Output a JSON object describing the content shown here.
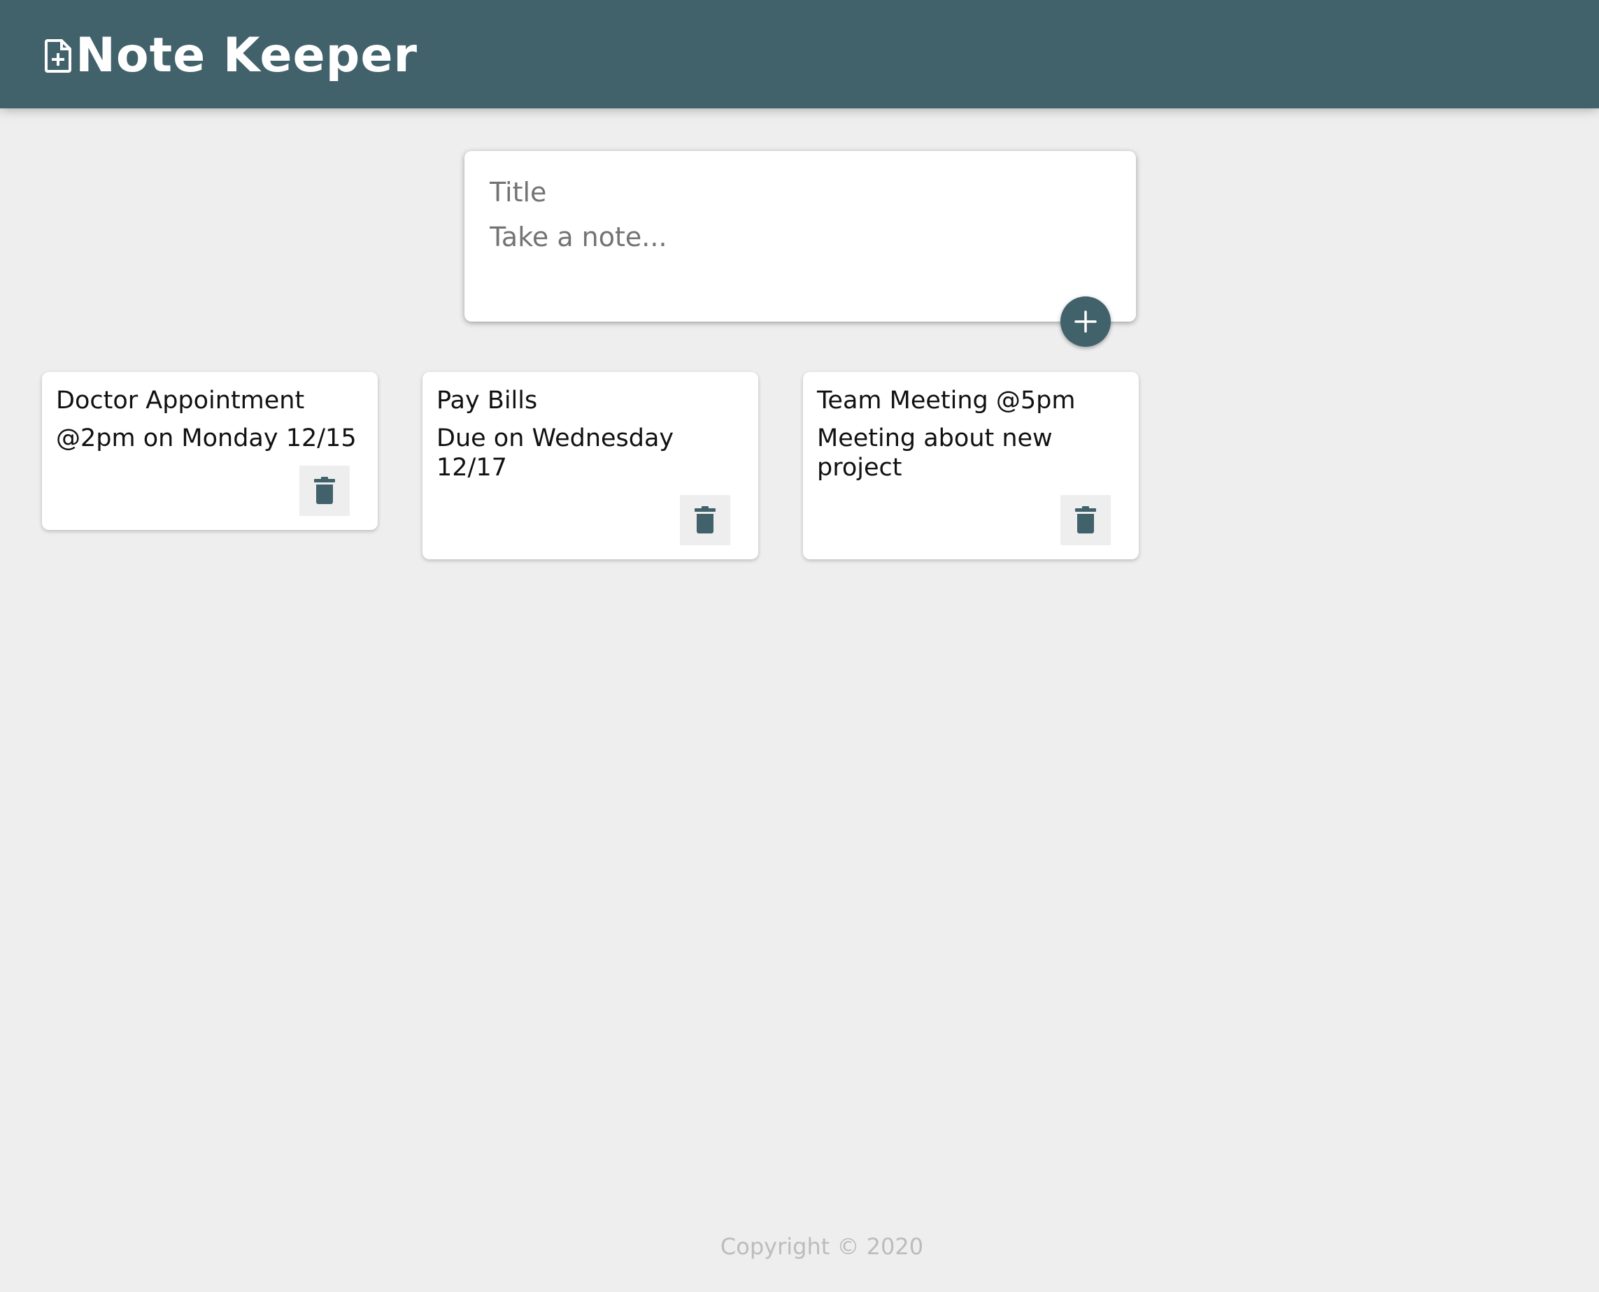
{
  "header": {
    "logo_icon": "note-add-icon",
    "title": "Note Keeper"
  },
  "composer": {
    "title_placeholder": "Title",
    "note_placeholder": "Take a note...",
    "add_icon": "plus-icon"
  },
  "notes": [
    {
      "title": "Doctor Appointment",
      "content": "@2pm on Monday 12/15",
      "delete_icon": "trash-icon"
    },
    {
      "title": "Pay Bills",
      "content": "Due on Wednesday 12/17",
      "delete_icon": "trash-icon"
    },
    {
      "title": "Team Meeting @5pm",
      "content": "Meeting about new project",
      "delete_icon": "trash-icon"
    }
  ],
  "footer": {
    "copyright": "Copyright © 2020"
  },
  "colors": {
    "primary": "#41616b",
    "background": "#eeeeee",
    "card": "#ffffff",
    "footer_text": "#bcbcbc"
  }
}
